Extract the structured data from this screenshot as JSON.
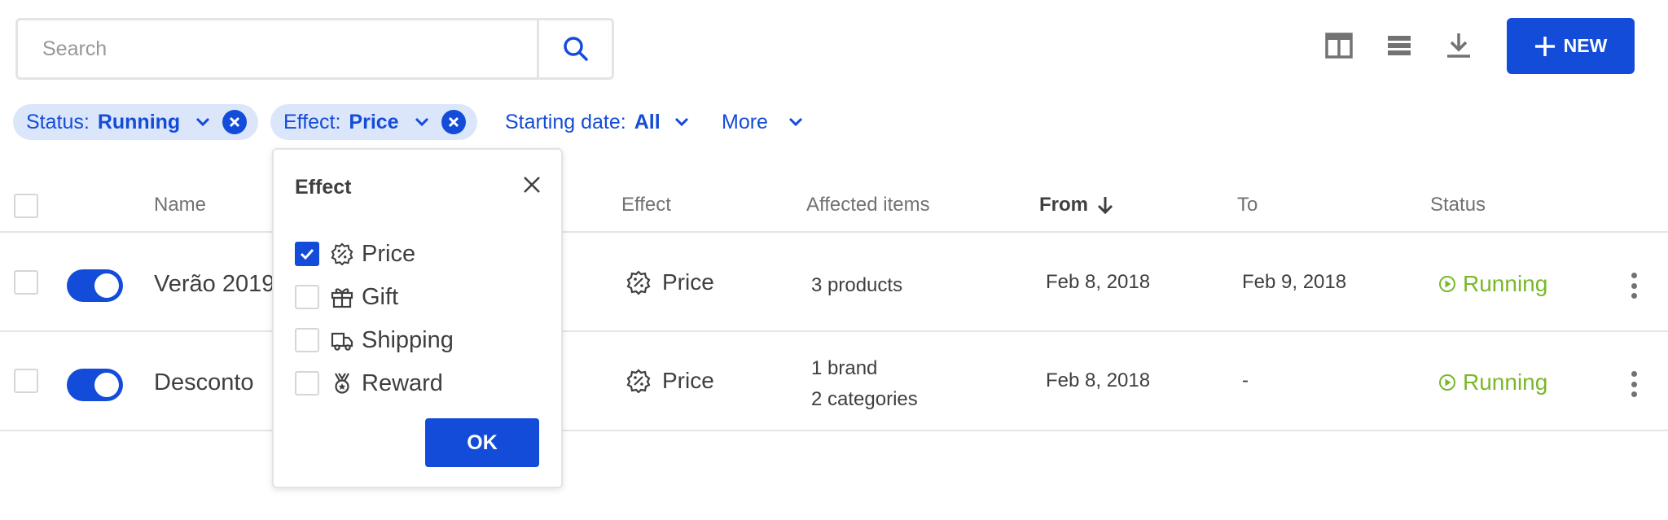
{
  "search": {
    "placeholder": "Search"
  },
  "toolbar": {
    "new_label": "NEW",
    "icons": [
      "columns-icon",
      "density-icon",
      "download-icon"
    ]
  },
  "filters": {
    "status": {
      "label": "Status:",
      "value": "Running"
    },
    "effect": {
      "label": "Effect:",
      "value": "Price"
    },
    "starting_date": {
      "label": "Starting date:",
      "value": "All"
    },
    "more": {
      "label": "More"
    }
  },
  "table": {
    "headers": {
      "name": "Name",
      "effect": "Effect",
      "affected": "Affected items",
      "from": "From",
      "to": "To",
      "status": "Status"
    },
    "rows": [
      {
        "name": "Verão 2019",
        "effect": "Price",
        "affected_1": "3 products",
        "affected_2": "",
        "from": "Feb 8, 2018",
        "to": "Feb 9, 2018",
        "status": "Running",
        "active": true
      },
      {
        "name": "Desconto",
        "effect": "Price",
        "affected_1": "1 brand",
        "affected_2": "2 categories",
        "from": "Feb 8, 2018",
        "to": "-",
        "status": "Running",
        "active": true
      }
    ]
  },
  "popover": {
    "title": "Effect",
    "options": [
      {
        "label": "Price",
        "checked": true,
        "icon": "price-tag-icon"
      },
      {
        "label": "Gift",
        "checked": false,
        "icon": "gift-icon"
      },
      {
        "label": "Shipping",
        "checked": false,
        "icon": "truck-icon"
      },
      {
        "label": "Reward",
        "checked": false,
        "icon": "medal-icon"
      }
    ],
    "ok_label": "OK"
  },
  "colors": {
    "primary": "#134cd8",
    "chip_bg": "#dbe6fb",
    "running": "#79b829",
    "border": "#e3e4e6",
    "muted": "#727273"
  }
}
